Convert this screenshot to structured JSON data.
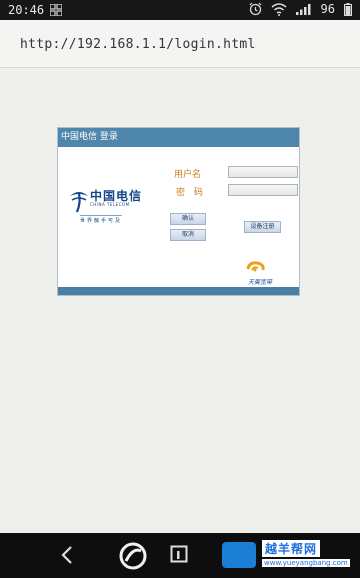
{
  "status_bar": {
    "time": "20:46",
    "battery": "96"
  },
  "browser": {
    "url": "http://192.168.1.1/login.html"
  },
  "login": {
    "header_title": "中国电信 登录",
    "logo_cn": "中国电信",
    "logo_en": "CHINA TELECOM",
    "logo_slogan": "世界触手可及",
    "username_label": "用户名",
    "password_label": "密 码",
    "username_value": "",
    "password_value": "",
    "confirm_label": "确认",
    "cancel_label": "取消",
    "register_label": "设备注册",
    "tianyi_label": "天翼宽带"
  },
  "watermark": {
    "brand_cn": "越羊帮网",
    "brand_url": "www.yueyangbang.com"
  },
  "colors": {
    "header_blue": "#4f86ac",
    "label_orange": "#d27a1e",
    "brand_blue": "#14468a"
  }
}
